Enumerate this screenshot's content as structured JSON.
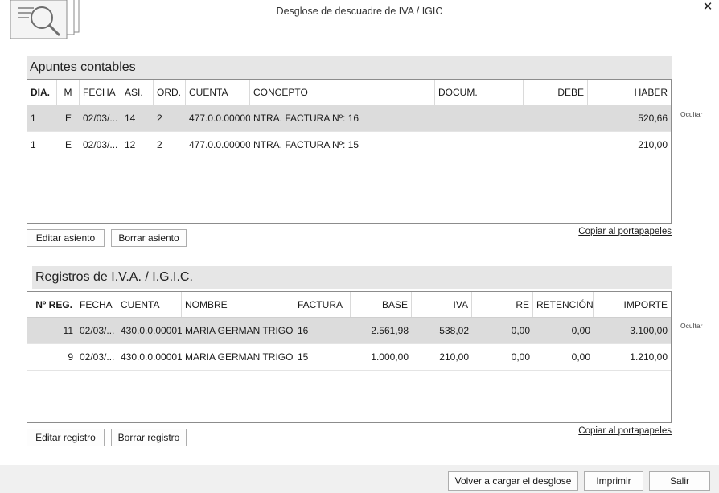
{
  "window": {
    "title": "Desglose de descuadre de IVA / IGIC",
    "close_glyph": "✕",
    "logo_icon": "document-search-icon"
  },
  "apuntes": {
    "section_title": "Apuntes contables",
    "columns": [
      "DIA.",
      "M",
      "FECHA",
      "ASI.",
      "ORD.",
      "CUENTA",
      "CONCEPTO",
      "DOCUM.",
      "DEBE",
      "HABER"
    ],
    "rows": [
      {
        "dia": "1",
        "m": "E",
        "fecha": "02/03/...",
        "asi": "14",
        "ord": "2",
        "cuenta": "477.0.0.00000",
        "concepto": "NTRA. FACTURA Nº:  16",
        "docum": "",
        "debe": "",
        "haber": "520,66"
      },
      {
        "dia": "1",
        "m": "E",
        "fecha": "02/03/...",
        "asi": "12",
        "ord": "2",
        "cuenta": "477.0.0.00000",
        "concepto": "NTRA. FACTURA Nº:  15",
        "docum": "",
        "debe": "",
        "haber": "210,00"
      }
    ],
    "side_label": "Ocultar",
    "edit_button": "Editar asiento",
    "delete_button": "Borrar asiento",
    "copy_link": "Copiar al portapapeles"
  },
  "registros": {
    "section_title": "Registros de I.V.A. / I.G.I.C.",
    "columns": [
      "Nº REG.",
      "FECHA",
      "CUENTA",
      "NOMBRE",
      "FACTURA",
      "BASE",
      "IVA",
      "RE",
      "RETENCIÓN",
      "IMPORTE"
    ],
    "rows": [
      {
        "reg": "11",
        "fecha": "02/03/...",
        "cuenta": "430.0.0.00001",
        "nombre": "MARIA GERMAN TRIGO",
        "factura": "16",
        "base": "2.561,98",
        "iva": "538,02",
        "re": "0,00",
        "retencion": "0,00",
        "importe": "3.100,00"
      },
      {
        "reg": "9",
        "fecha": "02/03/...",
        "cuenta": "430.0.0.00001",
        "nombre": "MARIA GERMAN TRIGO",
        "factura": "15",
        "base": "1.000,00",
        "iva": "210,00",
        "re": "0,00",
        "retencion": "0,00",
        "importe": "1.210,00"
      }
    ],
    "side_label": "Ocultar",
    "edit_button": "Editar registro",
    "delete_button": "Borrar registro",
    "copy_link": "Copiar al portapapeles"
  },
  "footer": {
    "reload_button": "Volver a cargar el desglose",
    "print_button": "Imprimir",
    "exit_button": "Salir"
  }
}
